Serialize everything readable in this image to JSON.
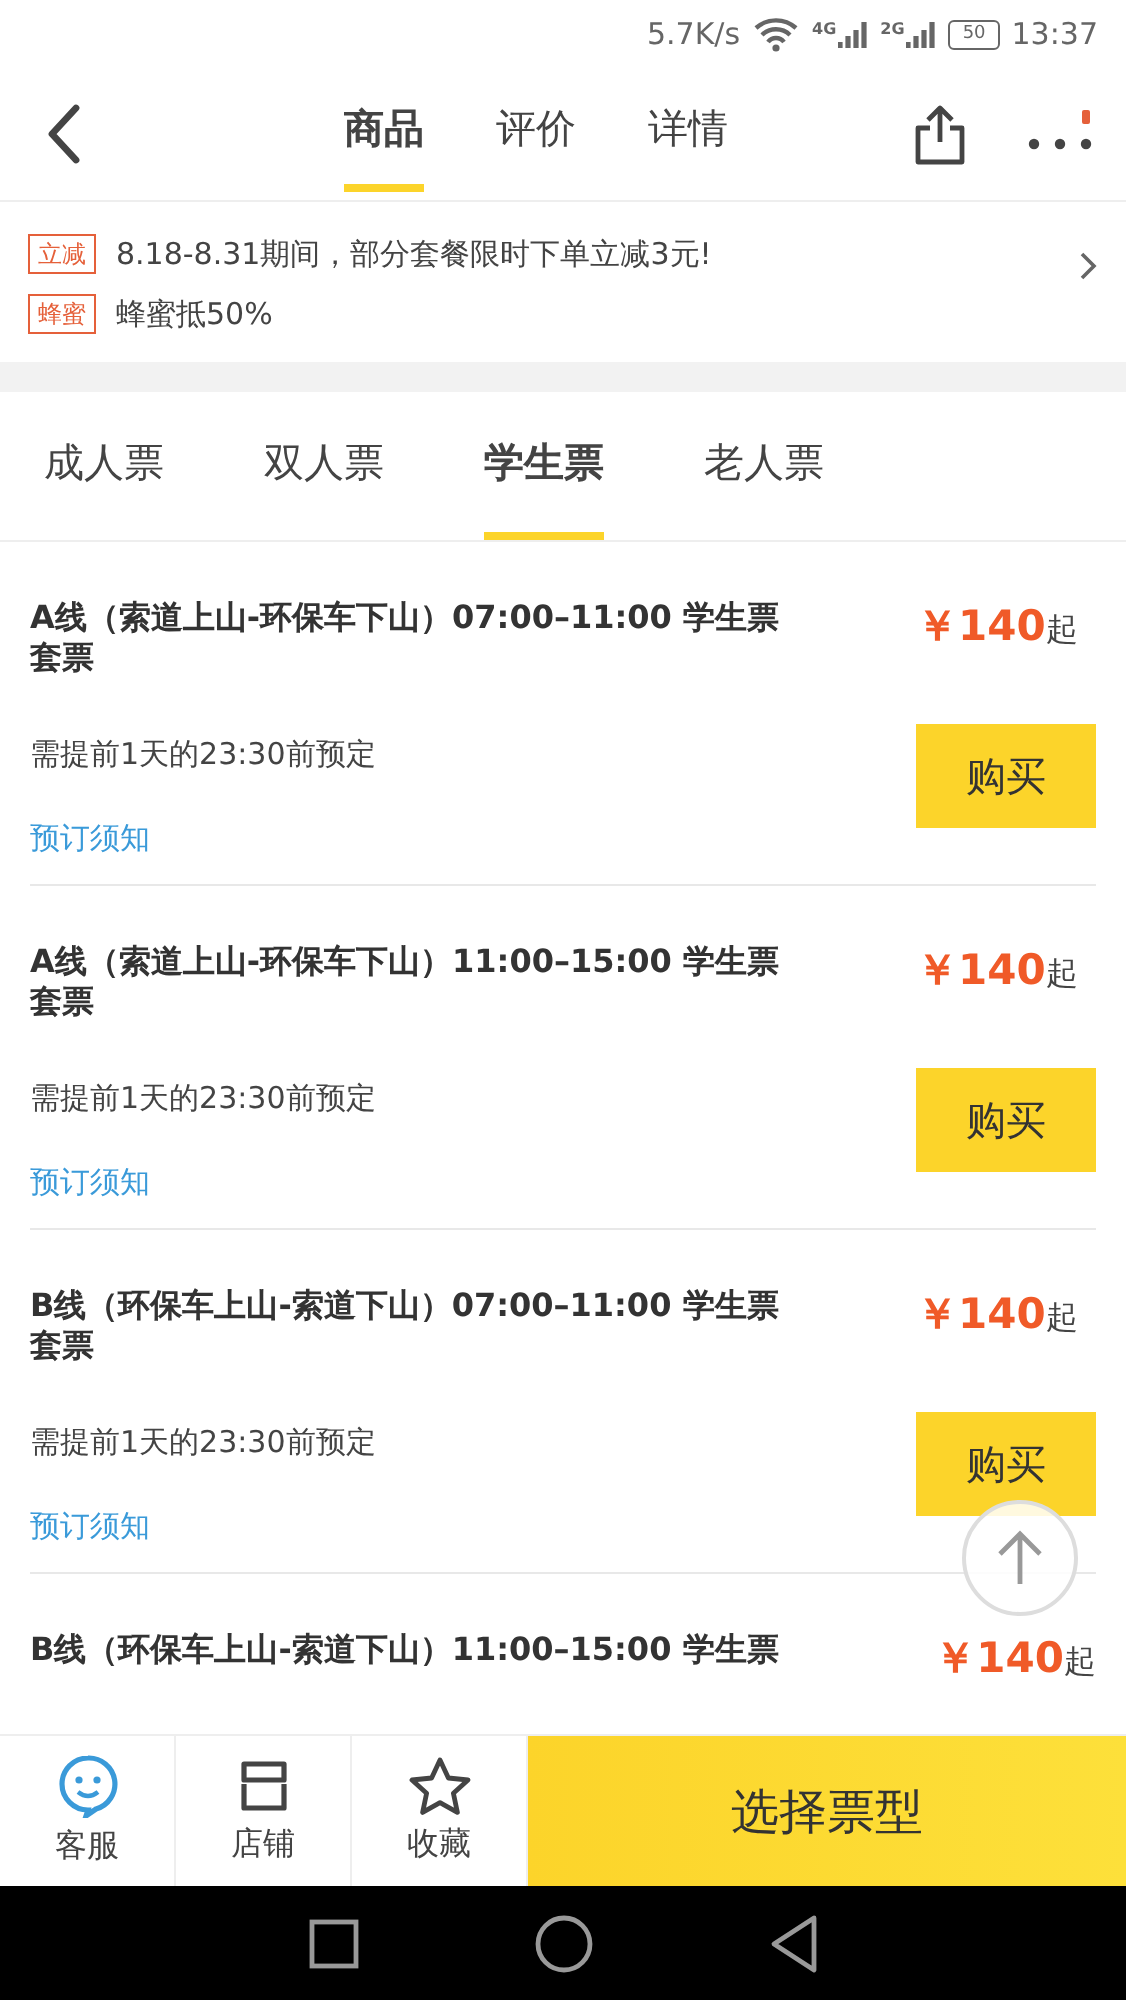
{
  "status_bar": {
    "speed": "5.7K/s",
    "network_1": "4G",
    "network_2": "2G",
    "battery": "50",
    "time": "13:37"
  },
  "header_tabs": [
    {
      "label": "商品",
      "selected": true
    },
    {
      "label": "评价",
      "selected": false
    },
    {
      "label": "详情",
      "selected": false
    }
  ],
  "more_badge": true,
  "promos": [
    {
      "tag": "立减",
      "text": "8.18-8.31期间，部分套餐限时下单立减3元!"
    },
    {
      "tag": "蜂蜜",
      "text": "蜂蜜抵50%"
    }
  ],
  "ticket_tabs": [
    {
      "label": "成人票",
      "selected": false
    },
    {
      "label": "双人票",
      "selected": false
    },
    {
      "label": "学生票",
      "selected": true
    },
    {
      "label": "老人票",
      "selected": false
    }
  ],
  "tickets": [
    {
      "title": "A线（索道上山-环保车下山）07:00–11:00 学生票套票",
      "price": "￥140",
      "price_suffix": "起",
      "note": "需提前1天的23:30前预定",
      "link": "预订须知",
      "buy": "购买"
    },
    {
      "title": "A线（索道上山-环保车下山）11:00–15:00 学生票套票",
      "price": "￥140",
      "price_suffix": "起",
      "note": "需提前1天的23:30前预定",
      "link": "预订须知",
      "buy": "购买"
    },
    {
      "title": "B线（环保车上山-索道下山）07:00–11:00 学生票套票",
      "price": "￥140",
      "price_suffix": "起",
      "note": "需提前1天的23:30前预定",
      "link": "预订须知",
      "buy": "购买"
    },
    {
      "title": "B线（环保车上山-索道下山）11:00–15:00 学生票",
      "price": "￥140",
      "price_suffix": "起"
    }
  ],
  "bottom_bar": {
    "items": [
      {
        "kind": "service",
        "label": "客服"
      },
      {
        "kind": "shop",
        "label": "店铺"
      },
      {
        "kind": "favorite",
        "label": "收藏"
      }
    ],
    "cta": "选择票型"
  }
}
